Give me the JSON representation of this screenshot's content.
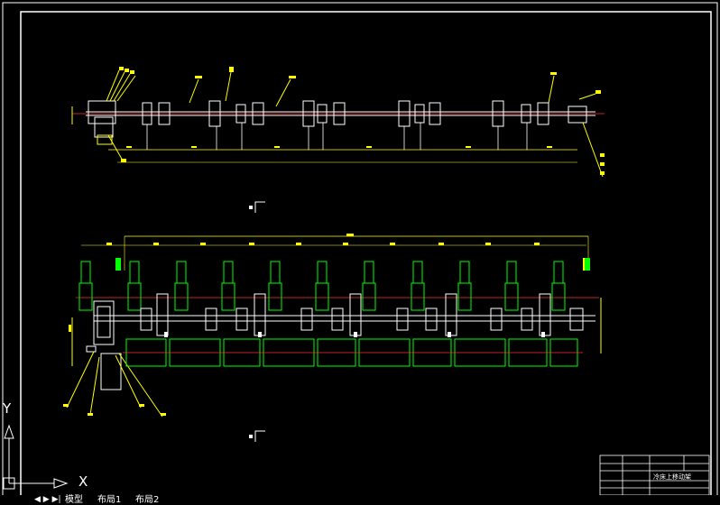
{
  "drawing": {
    "title_block_name": "冷床上移动架"
  },
  "ucs": {
    "x_label": "X",
    "y_label": "Y"
  },
  "layout_tabs": [
    {
      "label": "模型"
    },
    {
      "label": "布局1"
    },
    {
      "label": "布局2"
    }
  ],
  "colors": {
    "background": "#000000",
    "frame": "#ffffff",
    "part": "#ffffff",
    "dimension": "#ffff00",
    "green_parts": "#00ff00",
    "centerline": "#ff3030"
  }
}
